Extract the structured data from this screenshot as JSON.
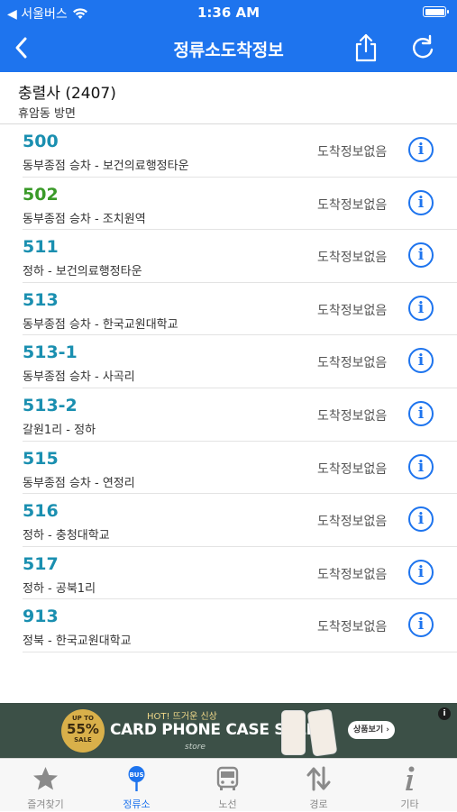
{
  "status_bar": {
    "carrier": "◀ 서울버스",
    "time": "1:36 AM"
  },
  "nav": {
    "title": "정류소도착정보"
  },
  "stop": {
    "name": "충렬사 (2407)",
    "direction": "휴암동 방면"
  },
  "buses": [
    {
      "number": "500",
      "route": "동부종점 승차 - 보건의료행정타운",
      "arrival": "도착정보없음"
    },
    {
      "number": "502",
      "route": "동부종점 승차 - 조치원역",
      "arrival": "도착정보없음"
    },
    {
      "number": "511",
      "route": "정하 - 보건의료행정타운",
      "arrival": "도착정보없음"
    },
    {
      "number": "513",
      "route": "동부종점 승차 - 한국교원대학교",
      "arrival": "도착정보없음"
    },
    {
      "number": "513-1",
      "route": "동부종점 승차 - 사곡리",
      "arrival": "도착정보없음"
    },
    {
      "number": "513-2",
      "route": "갈원1리 - 정하",
      "arrival": "도착정보없음"
    },
    {
      "number": "515",
      "route": "동부종점 승차 - 연정리",
      "arrival": "도착정보없음"
    },
    {
      "number": "516",
      "route": "정하 - 충청대학교",
      "arrival": "도착정보없음"
    },
    {
      "number": "517",
      "route": "정하 - 공북1리",
      "arrival": "도착정보없음"
    },
    {
      "number": "913",
      "route": "정북 - 한국교원대학교",
      "arrival": "도착정보없음"
    }
  ],
  "info_icon_glyph": "i",
  "ad": {
    "badge_top": "UP TO",
    "badge_percent": "55%",
    "badge_bottom": "SALE",
    "hot_text": "HOT! 뜨거운 신상",
    "headline": "CARD PHONE CASE SALE",
    "brand": "store",
    "cta": "상품보기 ›",
    "info": "i"
  },
  "tabs": [
    {
      "label": "즐겨찾기",
      "icon": "star-icon"
    },
    {
      "label": "정류소",
      "icon": "bus-stop-icon"
    },
    {
      "label": "노선",
      "icon": "bus-icon"
    },
    {
      "label": "경로",
      "icon": "route-arrows-icon"
    },
    {
      "label": "기타",
      "icon": "info-icon"
    }
  ],
  "colors": {
    "accent": "#1e74ee",
    "bus_number_default": "#1a8fb0",
    "bus_number_green": "#3a9a28",
    "tab_inactive": "#8a8a8a"
  }
}
